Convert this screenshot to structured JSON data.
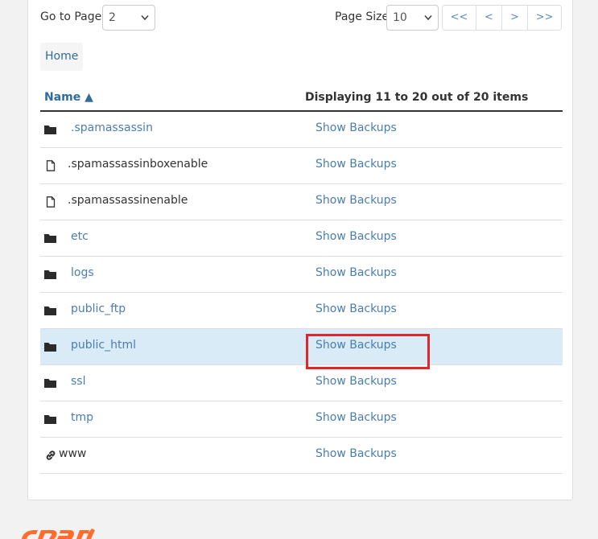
{
  "pagination": {
    "goto_label": "Go to Page:",
    "goto_value": "2",
    "page_size_label": "Page Size",
    "page_size_value": "10",
    "first_label": "<<",
    "prev_label": "<",
    "next_label": ">",
    "last_label": ">>"
  },
  "breadcrumb": {
    "home_label": "Home"
  },
  "table": {
    "name_header": "Name ▲",
    "display_header": "Displaying 11 to 20 out of 20 items",
    "action_label": "Show Backups",
    "rows": [
      {
        "name": ".spamassassin",
        "icon": "folder-icon",
        "link": true
      },
      {
        "name": ".spamassassinboxenable",
        "icon": "file-icon",
        "link": false
      },
      {
        "name": ".spamassassinenable",
        "icon": "file-icon",
        "link": false
      },
      {
        "name": "etc",
        "icon": "folder-icon",
        "link": true
      },
      {
        "name": "logs",
        "icon": "folder-icon",
        "link": true
      },
      {
        "name": "public_ftp",
        "icon": "folder-icon",
        "link": true
      },
      {
        "name": "public_html",
        "icon": "folder-icon",
        "link": true,
        "highlighted": true
      },
      {
        "name": "ssl",
        "icon": "folder-icon",
        "link": true
      },
      {
        "name": "tmp",
        "icon": "folder-icon",
        "link": true
      },
      {
        "name": "www",
        "icon": "link-icon",
        "link": false
      }
    ]
  },
  "colors": {
    "link": "#4a7eb0",
    "highlight_row": "#d9ebf7",
    "annotation": "#e0262d",
    "logo": "#ff6c2c"
  }
}
